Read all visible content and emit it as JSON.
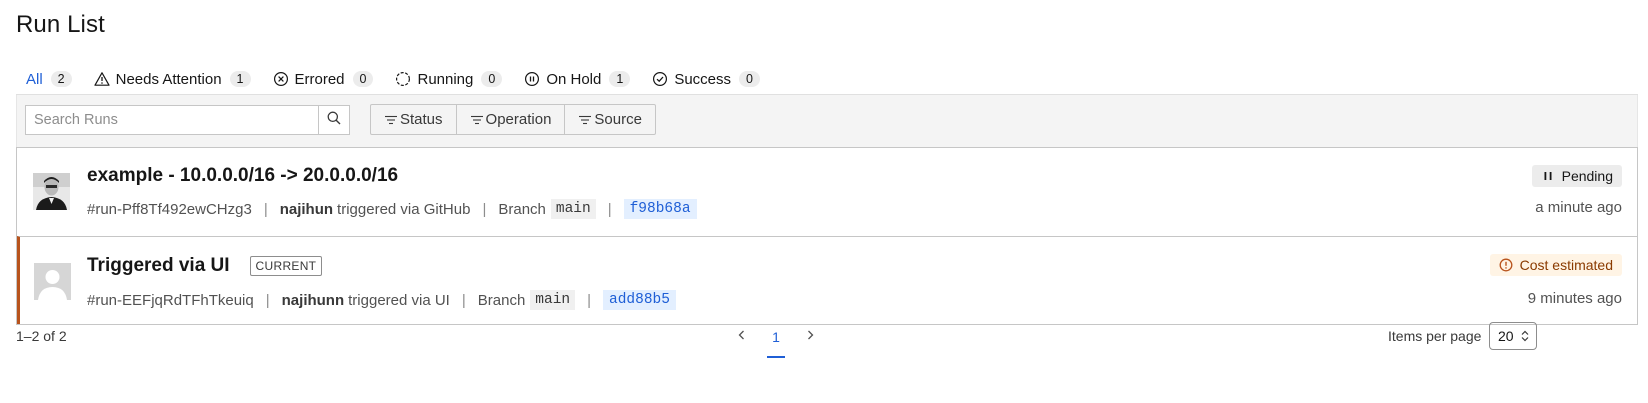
{
  "page": {
    "title": "Run List"
  },
  "tabs": [
    {
      "label": "All",
      "count": "2",
      "icon": "none",
      "active": true
    },
    {
      "label": "Needs Attention",
      "count": "1",
      "icon": "warning-icon"
    },
    {
      "label": "Errored",
      "count": "0",
      "icon": "error-circle-icon"
    },
    {
      "label": "Running",
      "count": "0",
      "icon": "running-circle-icon"
    },
    {
      "label": "On Hold",
      "count": "1",
      "icon": "pause-circle-icon"
    },
    {
      "label": "Success",
      "count": "0",
      "icon": "check-circle-icon"
    }
  ],
  "toolbar": {
    "search_placeholder": "Search Runs",
    "search_value": "",
    "filters": [
      "Status",
      "Operation",
      "Source"
    ]
  },
  "runs": [
    {
      "title": "example - 10.0.0.0/16 -> 20.0.0.0/16",
      "current": false,
      "id": "#run-Pff8Tf492ewCHzg3",
      "user": "najihun",
      "trigger_text": "triggered via GitHub",
      "branch_label": "Branch",
      "branch": "main",
      "sha": "f98b68a",
      "status": "Pending",
      "status_icon": "pause-icon",
      "time": "a minute ago",
      "avatar": "photo-avatar"
    },
    {
      "title": "Triggered via UI",
      "current": true,
      "current_tag": "CURRENT",
      "id": "#run-EEFjqRdTFhTkeuiq",
      "user": "najihunn",
      "trigger_text": "triggered via UI",
      "branch_label": "Branch",
      "branch": "main",
      "sha": "add88b5",
      "status": "Cost estimated",
      "status_icon": "alert-circle-icon",
      "time": "9 minutes ago",
      "avatar": "default-avatar"
    }
  ],
  "pagination": {
    "range": "1–2 of 2",
    "current_page": "1",
    "items_per_page_label": "Items per page",
    "items_per_page": "20"
  },
  "colors": {
    "accent": "#1f5fd6",
    "current_border": "#b8531c",
    "cost_badge_bg": "#fff4e5",
    "cost_badge_text": "#8a3a00"
  }
}
